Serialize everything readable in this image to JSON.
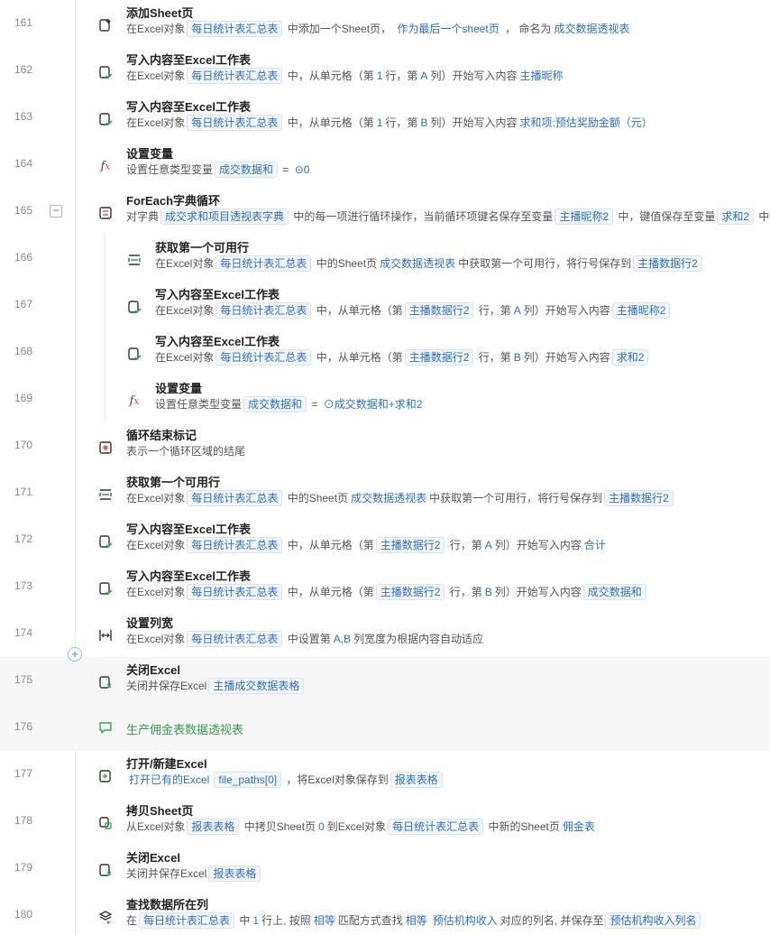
{
  "rows": [
    {
      "line": "161",
      "indent": 0,
      "icon": "add-sheet-icon",
      "title": "添加Sheet页",
      "desc": [
        [
          "t",
          "在Excel对象"
        ],
        [
          "c",
          "每日统计表汇总表"
        ],
        [
          "t",
          " 中添加一个Sheet页， "
        ],
        [
          "v",
          "作为最后一个sheet页"
        ],
        [
          "t",
          " ， 命名为"
        ],
        [
          "v",
          "成交数据透视表"
        ]
      ]
    },
    {
      "line": "162",
      "indent": 0,
      "icon": "write-excel-icon",
      "title": "写入内容至Excel工作表",
      "desc": [
        [
          "t",
          "在Excel对象"
        ],
        [
          "c",
          "每日统计表汇总表"
        ],
        [
          "t",
          " 中，从单元格（第"
        ],
        [
          "v",
          "1"
        ],
        [
          "t",
          "行，第"
        ],
        [
          "v",
          "A"
        ],
        [
          "t",
          "列）开始写入内容"
        ],
        [
          "v",
          "主播昵称"
        ]
      ]
    },
    {
      "line": "163",
      "indent": 0,
      "icon": "write-excel-icon",
      "title": "写入内容至Excel工作表",
      "desc": [
        [
          "t",
          "在Excel对象"
        ],
        [
          "c",
          "每日统计表汇总表"
        ],
        [
          "t",
          " 中，从单元格（第"
        ],
        [
          "v",
          "1"
        ],
        [
          "t",
          "行，第"
        ],
        [
          "v",
          "B"
        ],
        [
          "t",
          "列）开始写入内容"
        ],
        [
          "v",
          "求和项:预估奖励金额（元）"
        ]
      ]
    },
    {
      "line": "164",
      "indent": 0,
      "icon": "fx-icon",
      "title": "设置变量",
      "desc": [
        [
          "t",
          "设置任意类型变量"
        ],
        [
          "c",
          "成交数据和"
        ],
        [
          "t",
          " = "
        ],
        [
          "v",
          "⊙0"
        ]
      ]
    },
    {
      "line": "165",
      "indent": 0,
      "icon": "foreach-icon",
      "collapse": true,
      "title": "ForEach字典循环",
      "desc": [
        [
          "t",
          "对字典"
        ],
        [
          "c",
          "成交求和项目透视表字典"
        ],
        [
          "t",
          " 中的每一项进行循环操作，当前循环项键名保存至变量"
        ],
        [
          "c",
          "主播昵称2"
        ],
        [
          "t",
          " 中，键值保存至变量"
        ],
        [
          "c",
          "求和2"
        ],
        [
          "t",
          " 中"
        ]
      ]
    },
    {
      "line": "166",
      "indent": 1,
      "icon": "first-row-icon",
      "title": "获取第一个可用行",
      "desc": [
        [
          "t",
          "在Excel对象"
        ],
        [
          "c",
          "每日统计表汇总表"
        ],
        [
          "t",
          " 中的Sheet页"
        ],
        [
          "v",
          "成交数据透视表"
        ],
        [
          "t",
          "中获取第一个可用行，将行号保存到"
        ],
        [
          "c",
          "主播数据行2"
        ]
      ]
    },
    {
      "line": "167",
      "indent": 1,
      "icon": "write-excel-icon",
      "title": "写入内容至Excel工作表",
      "desc": [
        [
          "t",
          "在Excel对象"
        ],
        [
          "c",
          "每日统计表汇总表"
        ],
        [
          "t",
          " 中，从单元格（第"
        ],
        [
          "c",
          "主播数据行2"
        ],
        [
          "t",
          " 行，第"
        ],
        [
          "v",
          "A"
        ],
        [
          "t",
          "列）开始写入内容"
        ],
        [
          "c",
          "主播昵称2"
        ]
      ]
    },
    {
      "line": "168",
      "indent": 1,
      "icon": "write-excel-icon",
      "title": "写入内容至Excel工作表",
      "desc": [
        [
          "t",
          "在Excel对象"
        ],
        [
          "c",
          "每日统计表汇总表"
        ],
        [
          "t",
          " 中，从单元格（第"
        ],
        [
          "c",
          "主播数据行2"
        ],
        [
          "t",
          " 行，第"
        ],
        [
          "v",
          "B"
        ],
        [
          "t",
          "列）开始写入内容"
        ],
        [
          "c",
          "求和2"
        ]
      ]
    },
    {
      "line": "169",
      "indent": 1,
      "icon": "fx-icon",
      "title": "设置变量",
      "desc": [
        [
          "t",
          "设置任意类型变量"
        ],
        [
          "c",
          "成交数据和"
        ],
        [
          "t",
          " = "
        ],
        [
          "v",
          "⊙成交数据和+求和2"
        ]
      ]
    },
    {
      "line": "170",
      "indent": 0,
      "icon": "loop-end-icon",
      "title": "循环结束标记",
      "desc": [
        [
          "t",
          "表示一个循环区域的结尾"
        ]
      ]
    },
    {
      "line": "171",
      "indent": 0,
      "icon": "first-row-icon",
      "title": "获取第一个可用行",
      "desc": [
        [
          "t",
          "在Excel对象"
        ],
        [
          "c",
          "每日统计表汇总表"
        ],
        [
          "t",
          " 中的Sheet页"
        ],
        [
          "v",
          "成交数据透视表"
        ],
        [
          "t",
          "中获取第一个可用行，将行号保存到"
        ],
        [
          "c",
          "主播数据行2"
        ]
      ]
    },
    {
      "line": "172",
      "indent": 0,
      "icon": "write-excel-icon",
      "title": "写入内容至Excel工作表",
      "desc": [
        [
          "t",
          "在Excel对象"
        ],
        [
          "c",
          "每日统计表汇总表"
        ],
        [
          "t",
          " 中，从单元格（第"
        ],
        [
          "c",
          "主播数据行2"
        ],
        [
          "t",
          " 行，第"
        ],
        [
          "v",
          "A"
        ],
        [
          "t",
          "列）开始写入内容"
        ],
        [
          "v",
          "合计"
        ]
      ]
    },
    {
      "line": "173",
      "indent": 0,
      "icon": "write-excel-icon",
      "title": "写入内容至Excel工作表",
      "desc": [
        [
          "t",
          "在Excel对象"
        ],
        [
          "c",
          "每日统计表汇总表"
        ],
        [
          "t",
          " 中，从单元格（第"
        ],
        [
          "c",
          "主播数据行2"
        ],
        [
          "t",
          " 行，第"
        ],
        [
          "v",
          "B"
        ],
        [
          "t",
          "列）开始写入内容"
        ],
        [
          "c",
          "成交数据和"
        ]
      ]
    },
    {
      "line": "174",
      "indent": 0,
      "icon": "column-width-icon",
      "title": "设置列宽",
      "desc": [
        [
          "t",
          "在Excel对象"
        ],
        [
          "c",
          "每日统计表汇总表"
        ],
        [
          "t",
          " 中设置第"
        ],
        [
          "v",
          "A,B"
        ],
        [
          "t",
          "列宽度为根据内容自动适应"
        ]
      ]
    },
    {
      "line": "175",
      "indent": 0,
      "icon": "close-excel-icon",
      "hl": true,
      "title": "关闭Excel",
      "desc": [
        [
          "t",
          "关闭并保存Excel"
        ],
        [
          "c",
          "主播成交数据表格"
        ]
      ]
    },
    {
      "line": "176",
      "indent": 0,
      "icon": "comment-icon",
      "hl": true,
      "comment": "生产佣金表数据透视表"
    },
    {
      "line": "177",
      "indent": 0,
      "icon": "open-excel-icon",
      "title": "打开/新建Excel",
      "desc": [
        [
          "v",
          "打开已有的Excel"
        ],
        [
          "c",
          "file_paths[0]"
        ],
        [
          "t",
          " ，将Excel对象保存到"
        ],
        [
          "c",
          "报表表格"
        ]
      ]
    },
    {
      "line": "178",
      "indent": 0,
      "icon": "copy-sheet-icon",
      "title": "拷贝Sheet页",
      "desc": [
        [
          "t",
          "从Excel对象"
        ],
        [
          "c",
          "报表表格"
        ],
        [
          "t",
          " 中拷贝Sheet页"
        ],
        [
          "v",
          "0"
        ],
        [
          "t",
          "到Excel对象"
        ],
        [
          "c",
          "每日统计表汇总表"
        ],
        [
          "t",
          " 中新的Sheet页"
        ],
        [
          "v",
          "佣金表"
        ]
      ]
    },
    {
      "line": "179",
      "indent": 0,
      "icon": "close-excel-icon",
      "title": "关闭Excel",
      "desc": [
        [
          "t",
          "关闭并保存Excel"
        ],
        [
          "c",
          "报表表格"
        ]
      ]
    },
    {
      "line": "180",
      "indent": 0,
      "icon": "find-column-icon",
      "title": "查找数据所在列",
      "desc": [
        [
          "t",
          "在"
        ],
        [
          "c",
          "每日统计表汇总表"
        ],
        [
          "t",
          " 中"
        ],
        [
          "v",
          "1"
        ],
        [
          "t",
          "行上, 按照"
        ],
        [
          "v",
          "相等"
        ],
        [
          "t",
          "匹配方式查找"
        ],
        [
          "v",
          "相等"
        ],
        [
          "v",
          "预估机构收入"
        ],
        [
          "t",
          "对应的列名, 并保存至"
        ],
        [
          "c",
          "预估机构收入列名"
        ]
      ]
    }
  ],
  "colors": {
    "chip": "#2f6fc4",
    "comment": "#3a9a55",
    "icon_green": "#3aa655",
    "icon_red": "#e05a4a"
  }
}
